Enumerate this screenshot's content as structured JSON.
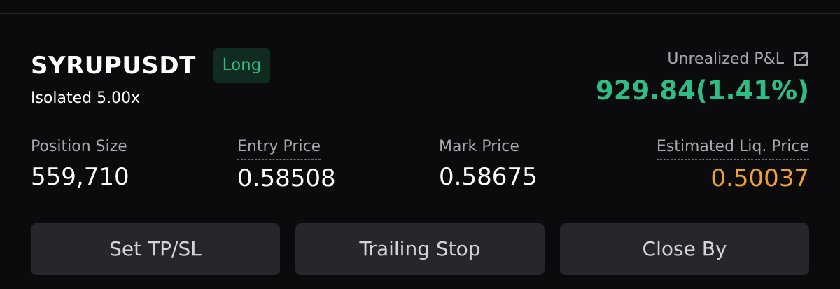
{
  "position": {
    "symbol": "SYRUPUSDT",
    "side": "Long",
    "margin_mode": "Isolated 5.00x"
  },
  "pnl": {
    "label": "Unrealized P&L",
    "value": "929.84(1.41%)"
  },
  "stats": {
    "position_size": {
      "label": "Position Size",
      "value": "559,710"
    },
    "entry_price": {
      "label": "Entry Price",
      "value": "0.58508"
    },
    "mark_price": {
      "label": "Mark Price",
      "value": "0.58675"
    },
    "liq_price": {
      "label": "Estimated Liq. Price",
      "value": "0.50037"
    }
  },
  "actions": {
    "set_tpsl": "Set TP/SL",
    "trailing_stop": "Trailing Stop",
    "close_by": "Close By"
  },
  "colors": {
    "background": "#0b0b0e",
    "long_green": "#2ebd85",
    "liq_orange": "#f0a22e",
    "button_bg": "#25272d"
  },
  "icons": {
    "share": "external-link-icon"
  }
}
